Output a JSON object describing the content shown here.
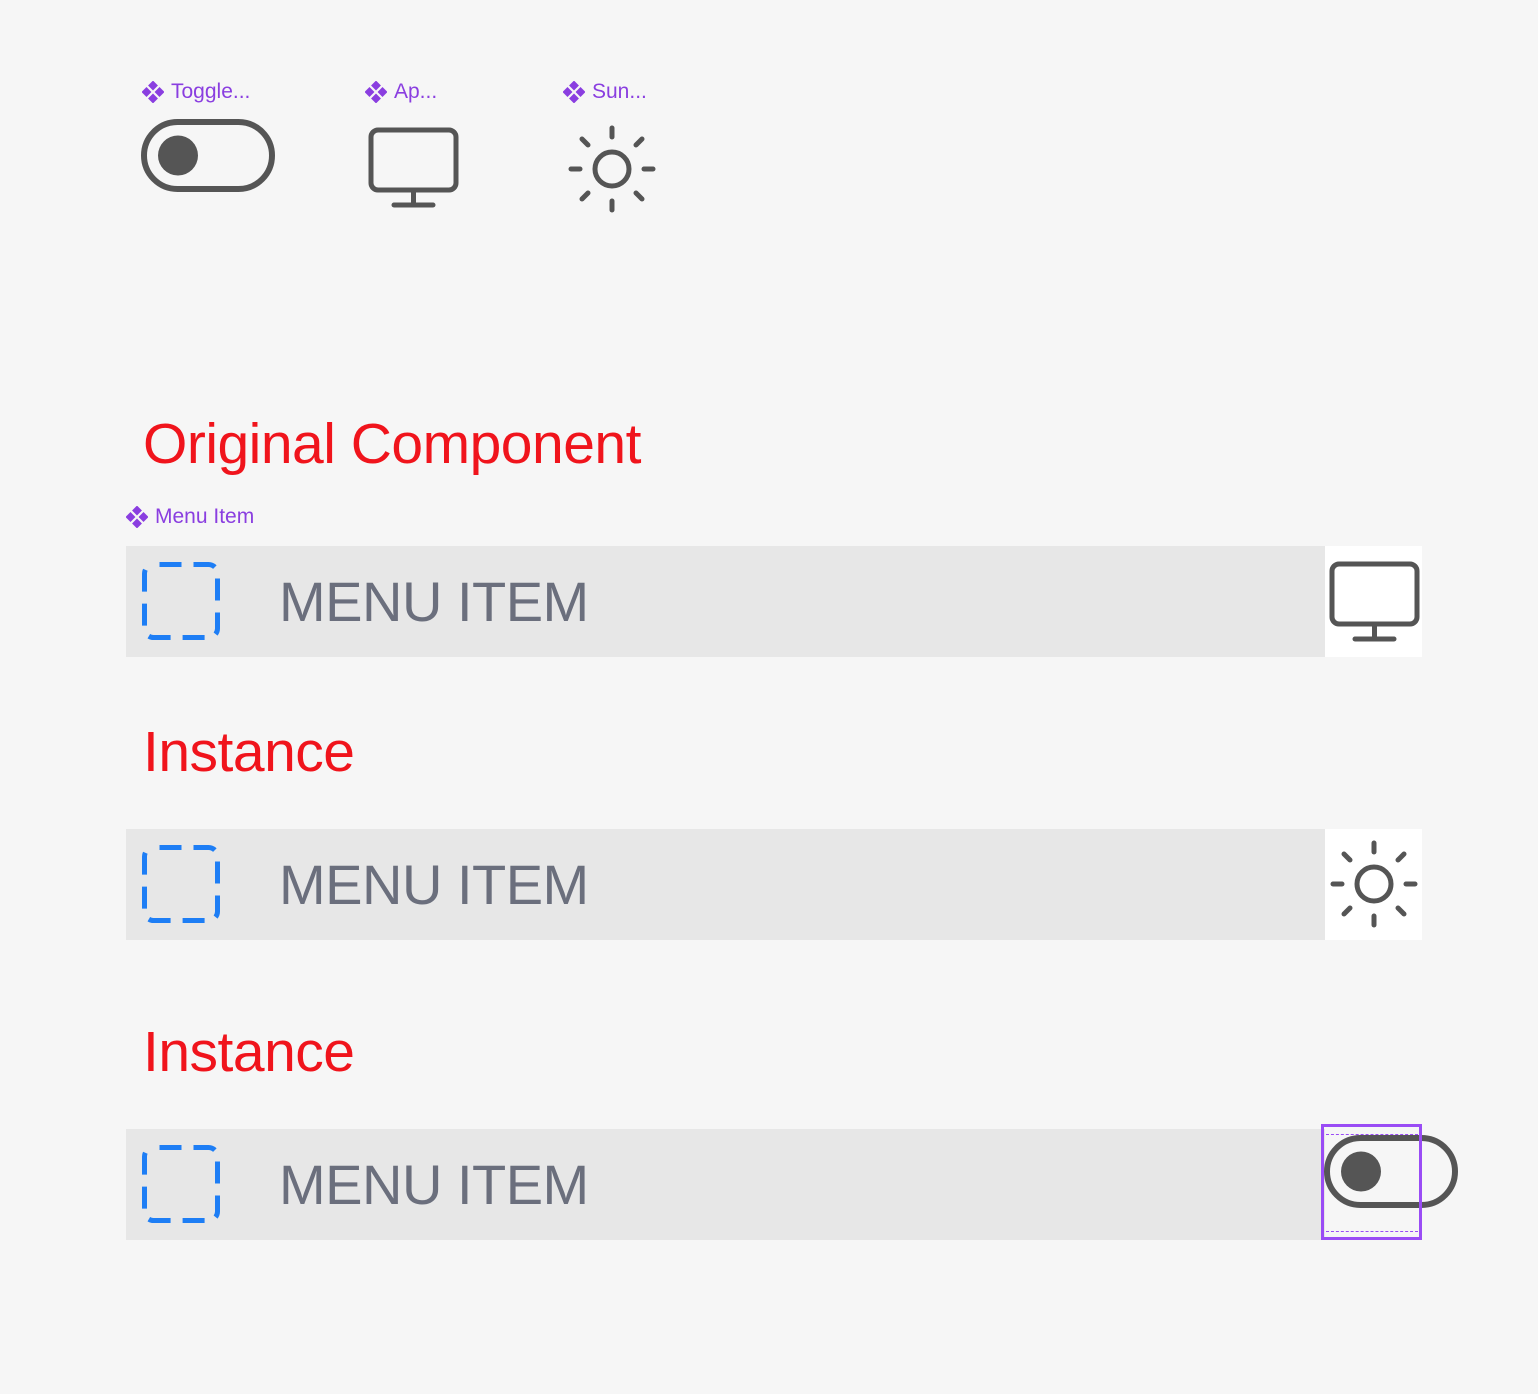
{
  "components": {
    "toggle_label": "Toggle...",
    "appearance_label": "Ap...",
    "sun_label": "Sun..."
  },
  "sections": {
    "original_heading": "Original Component",
    "menu_item_label": "Menu Item",
    "instance_heading_1": "Instance",
    "instance_heading_2": "Instance"
  },
  "rows": [
    {
      "label": "MENU ITEM",
      "trailing_icon": "monitor-icon"
    },
    {
      "label": "MENU ITEM",
      "trailing_icon": "sun-icon"
    },
    {
      "label": "MENU ITEM",
      "trailing_icon": "toggle-icon"
    }
  ],
  "colors": {
    "background": "#f6f6f6",
    "component_label": "#8a3ee0",
    "heading": "#f0141c",
    "row_background": "#e7e7e7",
    "row_text": "#6b6f7d",
    "placeholder": "#1e7ef5",
    "icon": "#555555",
    "selection": "#9a4cf5"
  }
}
